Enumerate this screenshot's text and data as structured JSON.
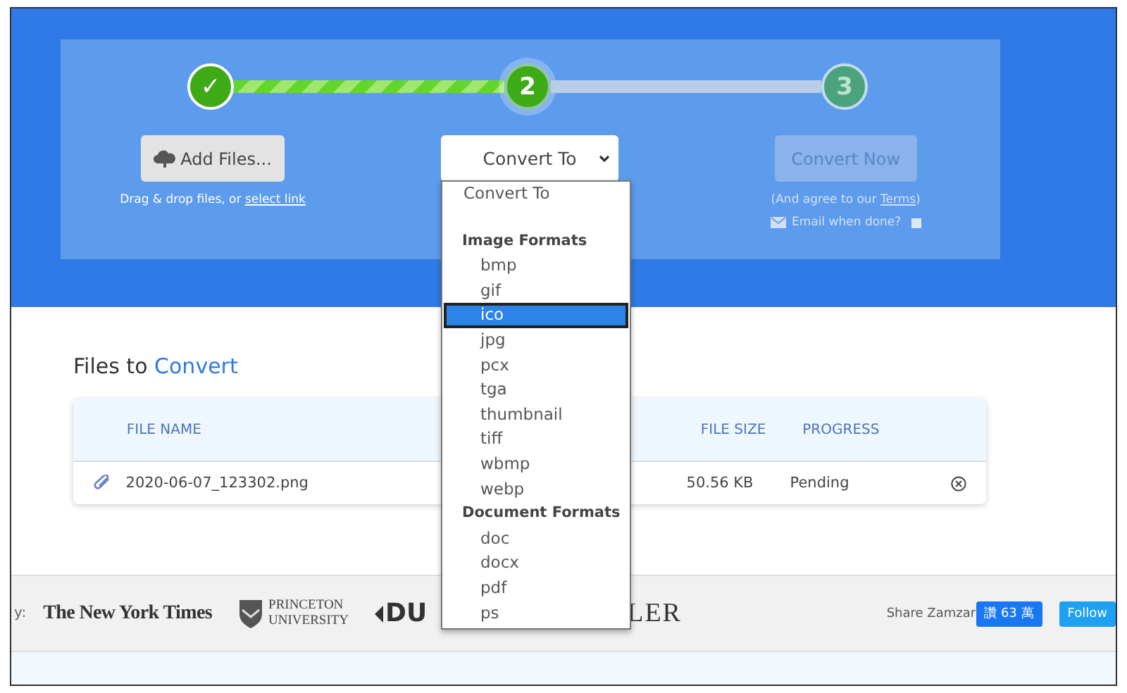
{
  "steps": [
    {
      "label": "✓",
      "completed": true,
      "selected": false
    },
    {
      "label": "2",
      "completed": false,
      "selected": true
    },
    {
      "label": "3",
      "completed": false,
      "selected": false
    }
  ],
  "add_files": {
    "label": "Add Files...",
    "hint": "Drag & drop files, or",
    "hint_link": "select link"
  },
  "format_select": {
    "value": "Convert To",
    "expanded": true,
    "menu": {
      "first_option": "Convert To",
      "groups": [
        {
          "label": "Image Formats",
          "options": [
            {
              "label": "bmp",
              "selected": false
            },
            {
              "label": "gif",
              "selected": false
            },
            {
              "label": "ico",
              "selected": true
            },
            {
              "label": "jpg",
              "selected": false
            },
            {
              "label": "pcx",
              "selected": false
            },
            {
              "label": "tga",
              "selected": false
            },
            {
              "label": "thumbnail",
              "selected": false
            },
            {
              "label": "tiff",
              "selected": false
            },
            {
              "label": "wbmp",
              "selected": false
            },
            {
              "label": "webp",
              "selected": false
            }
          ]
        },
        {
          "label": "Document Formats",
          "options": [
            {
              "label": "doc",
              "selected": false
            },
            {
              "label": "docx",
              "selected": false
            },
            {
              "label": "pdf",
              "selected": false
            },
            {
              "label": "ps",
              "selected": false
            }
          ]
        }
      ]
    }
  },
  "convert": {
    "label": "Convert Now",
    "disabled": true,
    "note_before": "(And agree to our",
    "note_link": "Terms",
    "note_after": ")",
    "email_label": "Email when done?",
    "email_checked": false
  },
  "files": {
    "title": "Files to",
    "title_highlight": "Convert"
  },
  "table": {
    "columns": [
      "FILE NAME",
      "FILE SIZE",
      "PROGRESS"
    ],
    "rows": [
      {
        "name": "2020-06-07_123302.png",
        "size": "50.56 KB",
        "progress": "Pending"
      }
    ]
  },
  "press": {
    "label": "y:",
    "logos": [
      {
        "kind": "blackletter",
        "text": "The New York Times"
      },
      {
        "kind": "crest",
        "text": "PRINCETON",
        "subtext": "UNIVERSITY"
      },
      {
        "kind": "bold",
        "text": "DU"
      },
      {
        "kind": "serif",
        "text": "LER"
      }
    ]
  },
  "share": {
    "label": "Share Zamzar",
    "buttons": [
      {
        "kind": "facebook",
        "label": "讚 63 萬"
      },
      {
        "kind": "twitter",
        "label": "Follow"
      }
    ]
  }
}
